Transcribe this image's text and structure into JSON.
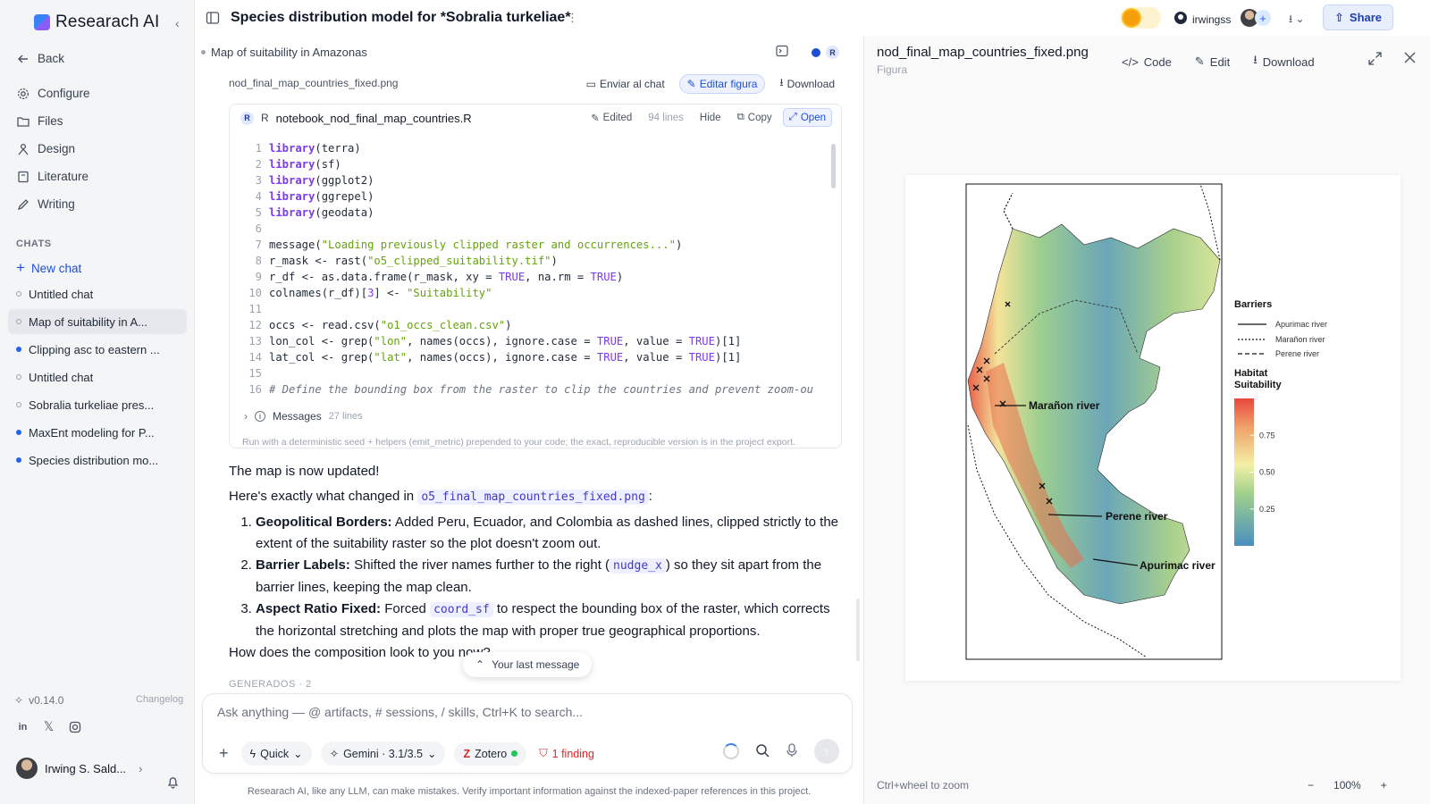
{
  "app": {
    "name": "Researach AI"
  },
  "nav": {
    "back": "Back",
    "items": [
      {
        "label": "Configure",
        "icon": "gear-icon"
      },
      {
        "label": "Files",
        "icon": "folder-icon"
      },
      {
        "label": "Design",
        "icon": "design-icon"
      },
      {
        "label": "Literature",
        "icon": "book-icon"
      },
      {
        "label": "Writing",
        "icon": "pen-icon"
      }
    ]
  },
  "chats": {
    "header": "CHATS",
    "new_chat": "New chat",
    "items": [
      {
        "label": "Untitled chat",
        "dot": "hollow"
      },
      {
        "label": "Map of suitability in A...",
        "dot": "hollow",
        "active": true
      },
      {
        "label": "Clipping asc to eastern ...",
        "dot": "fill"
      },
      {
        "label": "Untitled chat",
        "dot": "hollow"
      },
      {
        "label": "Sobralia turkeliae pres...",
        "dot": "hollow"
      },
      {
        "label": "MaxEnt modeling for P...",
        "dot": "fill"
      },
      {
        "label": "Species distribution mo...",
        "dot": "fill"
      }
    ]
  },
  "footer": {
    "version": "v0.14.0",
    "changelog": "Changelog",
    "user": "Irwing S. Sald..."
  },
  "topbar": {
    "title": "Species distribution model for *Sobralia turkeliae*",
    "github_user": "irwingss",
    "share": "Share"
  },
  "chat": {
    "breadcrumb": "Map of suitability in Amazonas",
    "file_name": "nod_final_map_countries_fixed.png",
    "actions": {
      "send": "Enviar al chat",
      "edit": "Editar figura",
      "download": "Download"
    },
    "code": {
      "lang": "R",
      "file": "notebook_nod_final_map_countries.R",
      "edited": "Edited",
      "lines": "94 lines",
      "hide": "Hide",
      "copy": "Copy",
      "open": "Open"
    },
    "messages": {
      "label": "Messages",
      "count": "27 lines"
    },
    "seed_note": "Run with a deterministic seed + helpers (emit_metric) prepended to your code; the exact, reproducible version is in the project export.",
    "answer": {
      "p1": "The map is now updated!",
      "p2_pre": "Here's exactly what changed in",
      "p2_code": "o5_final_map_countries_fixed.png",
      "p2_post": ":",
      "items": [
        {
          "bold": "Geopolitical Borders:",
          "text": "Added Peru, Ecuador, and Colombia as dashed lines, clipped strictly to the extent of the suitability raster so the plot doesn't zoom out."
        },
        {
          "bold": "Barrier Labels:",
          "text_pre": "Shifted the river names further to the right (",
          "code": "nudge_x",
          "text_post": ") so they sit apart from the barrier lines, keeping the map clean."
        },
        {
          "bold": "Aspect Ratio Fixed:",
          "text_pre": "Forced",
          "code": "coord_sf",
          "text_post": "to respect the bounding box of the raster, which corrects the horizontal stretching and plots the map with proper true geographical proportions."
        }
      ],
      "p3": "How does the composition look to you now?"
    },
    "last_message": "Your last message",
    "generados": "GENERADOS · 2",
    "composer": {
      "placeholder": "Ask anything — @ artifacts, # sessions, / skills, Ctrl+K to search...",
      "mode": "Quick",
      "model": "Gemini · 3.1/3.5",
      "zotero": "Zotero",
      "finding": "1 finding"
    },
    "disclaimer": "Researach AI, like any LLM, can make mistakes. Verify important information against the indexed-paper references in this project."
  },
  "right": {
    "title": "nod_final_map_countries_fixed.png",
    "subtitle": "Figura",
    "actions": {
      "code": "Code",
      "edit": "Edit",
      "download": "Download"
    },
    "zoom_hint": "Ctrl+wheel to zoom",
    "zoom": "100%"
  },
  "map": {
    "legend_barriers_title": "Barriers",
    "barriers": [
      {
        "name": "Apurimac river",
        "dash": "solid"
      },
      {
        "name": "Marañon river",
        "dash": "dotted"
      },
      {
        "name": "Perene river",
        "dash": "dashed"
      }
    ],
    "legend_suit_title": [
      "Habitat",
      "Suitability"
    ],
    "suit_ticks": [
      {
        "label": "0.75",
        "value": 0.75
      },
      {
        "label": "0.50",
        "value": 0.5
      },
      {
        "label": "0.25",
        "value": 0.25
      }
    ],
    "river_labels": [
      "Marañon river",
      "Perene river",
      "Apurimac river"
    ],
    "colors": {
      "low": "#4a8fbf",
      "mid": "#f3f0a6",
      "high": "#e8483c"
    }
  }
}
